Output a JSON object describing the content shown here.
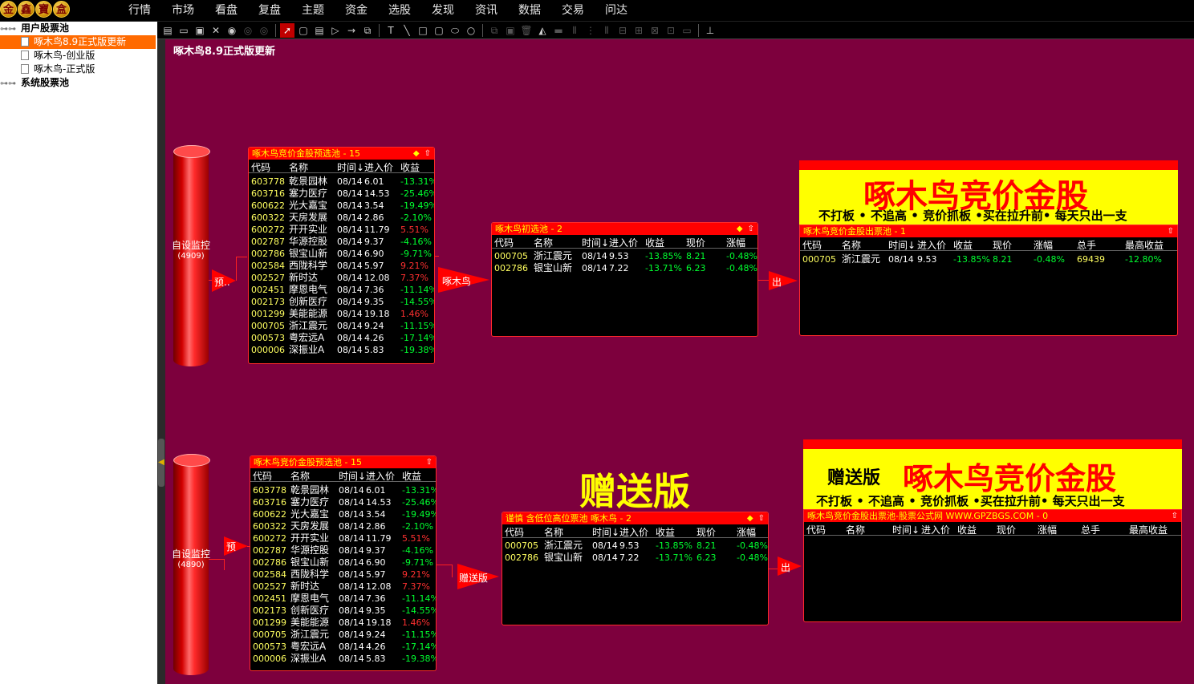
{
  "logo": [
    "金",
    "鑫",
    "寶",
    "盒"
  ],
  "menu": [
    "行情",
    "市场",
    "看盘",
    "复盘",
    "主题",
    "资金",
    "选股",
    "发现",
    "资讯",
    "数据",
    "交易",
    "问达"
  ],
  "toolbar": {
    "icons": [
      "new-icon",
      "open-icon",
      "save-icon",
      "close-icon",
      "play-icon",
      "pause-icon",
      "stop-icon",
      "pointer-icon",
      "circle-node-icon",
      "list-node-icon",
      "triangle-node-icon",
      "arrow-icon",
      "multi-node-icon",
      "text-icon",
      "line-icon",
      "rect-icon",
      "rounded-rect-icon",
      "ellipse-icon",
      "circle-icon",
      "copy-icon",
      "paste-icon",
      "delete-icon",
      "fill-icon",
      "align-icons",
      "tree-icon"
    ]
  },
  "sidebar": {
    "items": [
      {
        "label": "用户股票池",
        "bold": true
      },
      {
        "label": "啄木鸟8.9正式版更新",
        "selected": true
      },
      {
        "label": "啄木鸟-创业版"
      },
      {
        "label": "啄木鸟-正式版"
      },
      {
        "label": "系统股票池",
        "bold": true
      }
    ]
  },
  "canvas_title": "啄木鸟8.9正式版更新",
  "flow1": {
    "cylinder": {
      "label": "自设监控",
      "count": "(4909)"
    },
    "pre_arrow": "预..",
    "pool": {
      "title": "啄木鸟竞价金股预选池 - 15",
      "columns": [
        "代码",
        "名称",
        "时间↓",
        "进入价",
        "收益"
      ],
      "rows": [
        [
          "603778",
          "乾景园林",
          "08/14",
          "6.01",
          "-13.31%"
        ],
        [
          "603716",
          "塞力医疗",
          "08/14",
          "14.53",
          "-25.46%"
        ],
        [
          "600622",
          "光大嘉宝",
          "08/14",
          "3.54",
          "-19.49%"
        ],
        [
          "600322",
          "天房发展",
          "08/14",
          "2.86",
          "-2.10%"
        ],
        [
          "600272",
          "开开实业",
          "08/14",
          "11.79",
          "5.51%"
        ],
        [
          "002787",
          "华源控股",
          "08/14",
          "9.37",
          "-4.16%"
        ],
        [
          "002786",
          "银宝山新",
          "08/14",
          "6.90",
          "-9.71%"
        ],
        [
          "002584",
          "西陇科学",
          "08/14",
          "5.97",
          "9.21%"
        ],
        [
          "002527",
          "新时达",
          "08/14",
          "12.08",
          "7.37%"
        ],
        [
          "002451",
          "摩恩电气",
          "08/14",
          "7.36",
          "-11.14%"
        ],
        [
          "002173",
          "创新医疗",
          "08/14",
          "9.35",
          "-14.55%"
        ],
        [
          "001299",
          "美能能源",
          "08/14",
          "19.18",
          "1.46%"
        ],
        [
          "000705",
          "浙江震元",
          "08/14",
          "9.24",
          "-11.15%"
        ],
        [
          "000573",
          "粤宏远A",
          "08/14",
          "4.26",
          "-17.14%"
        ],
        [
          "000006",
          "深振业A",
          "08/14",
          "5.83",
          "-19.38%"
        ]
      ]
    },
    "mid_arrow": "啄木鸟",
    "init": {
      "title": "啄木鸟初选池 - 2",
      "columns": [
        "代码",
        "名称",
        "时间↓",
        "进入价",
        "收益",
        "现价",
        "涨幅"
      ],
      "rows": [
        [
          "000705",
          "浙江震元",
          "08/14",
          "9.53",
          "-13.85%",
          "8.21",
          "-0.48%"
        ],
        [
          "002786",
          "银宝山新",
          "08/14",
          "7.22",
          "-13.71%",
          "6.23",
          "-0.48%"
        ]
      ]
    },
    "out_arrow": "出",
    "banner": {
      "big": "啄木鸟竞价金股",
      "slogan": "不打板 • 不追高 • 竞价抓板 •买在拉升前• 每天只出一支"
    },
    "out": {
      "title": "啄木鸟竞价金股出票池 - 1",
      "columns": [
        "代码",
        "名称",
        "时间↓",
        "进入价",
        "收益",
        "现价",
        "涨幅",
        "总手",
        "最高收益"
      ],
      "rows": [
        [
          "000705",
          "浙江震元",
          "08/14",
          "9.53",
          "-13.85%",
          "8.21",
          "-0.48%",
          "69439",
          "-12.80%"
        ]
      ]
    }
  },
  "flow2": {
    "cylinder": {
      "label": "自设监控",
      "count": "(4890)"
    },
    "pre_arrow": "预",
    "pool": {
      "title": "啄木鸟竞价金股预选池 - 15",
      "columns": [
        "代码",
        "名称",
        "时间↓",
        "进入价",
        "收益"
      ],
      "rows": [
        [
          "603778",
          "乾景园林",
          "08/14",
          "6.01",
          "-13.31%"
        ],
        [
          "603716",
          "塞力医疗",
          "08/14",
          "14.53",
          "-25.46%"
        ],
        [
          "600622",
          "光大嘉宝",
          "08/14",
          "3.54",
          "-19.49%"
        ],
        [
          "600322",
          "天房发展",
          "08/14",
          "2.86",
          "-2.10%"
        ],
        [
          "600272",
          "开开实业",
          "08/14",
          "11.79",
          "5.51%"
        ],
        [
          "002787",
          "华源控股",
          "08/14",
          "9.37",
          "-4.16%"
        ],
        [
          "002786",
          "银宝山新",
          "08/14",
          "6.90",
          "-9.71%"
        ],
        [
          "002584",
          "西陇科学",
          "08/14",
          "5.97",
          "9.21%"
        ],
        [
          "002527",
          "新时达",
          "08/14",
          "12.08",
          "7.37%"
        ],
        [
          "002451",
          "摩恩电气",
          "08/14",
          "7.36",
          "-11.14%"
        ],
        [
          "002173",
          "创新医疗",
          "08/14",
          "9.35",
          "-14.55%"
        ],
        [
          "001299",
          "美能能源",
          "08/14",
          "19.18",
          "1.46%"
        ],
        [
          "000705",
          "浙江震元",
          "08/14",
          "9.24",
          "-11.15%"
        ],
        [
          "000573",
          "粤宏远A",
          "08/14",
          "4.26",
          "-17.14%"
        ],
        [
          "000006",
          "深振业A",
          "08/14",
          "5.83",
          "-19.38%"
        ]
      ]
    },
    "big_label": "赠送版",
    "mid_arrow": "赠送版",
    "init": {
      "title": "谨慎 含低位高位票池 啄木鸟 - 2",
      "columns": [
        "代码",
        "名称",
        "时间↓",
        "进入价",
        "收益",
        "现价",
        "涨幅"
      ],
      "rows": [
        [
          "000705",
          "浙江震元",
          "08/14",
          "9.53",
          "-13.85%",
          "8.21",
          "-0.48%"
        ],
        [
          "002786",
          "银宝山新",
          "08/14",
          "7.22",
          "-13.71%",
          "6.23",
          "-0.48%"
        ]
      ]
    },
    "out_arrow": "出",
    "banner": {
      "prefix": "赠送版",
      "big": "啄木鸟竞价金股",
      "slogan": "不打板 • 不追高 • 竞价抓板 •买在拉升前• 每天只出一支"
    },
    "out": {
      "title": "啄木鸟竞价金股出票池-股票公式网 WWW.GPZBGS.COM - 0",
      "columns": [
        "代码",
        "名称",
        "时间↓",
        "进入价",
        "收益",
        "现价",
        "涨幅",
        "总手",
        "最高收益"
      ],
      "rows": []
    }
  },
  "colors": {
    "canvas": "#7d003d",
    "panel_header": "#ff0000",
    "up": "#ff3030",
    "down": "#00ff30",
    "code": "#ffff60",
    "banner": "#ffff00"
  }
}
